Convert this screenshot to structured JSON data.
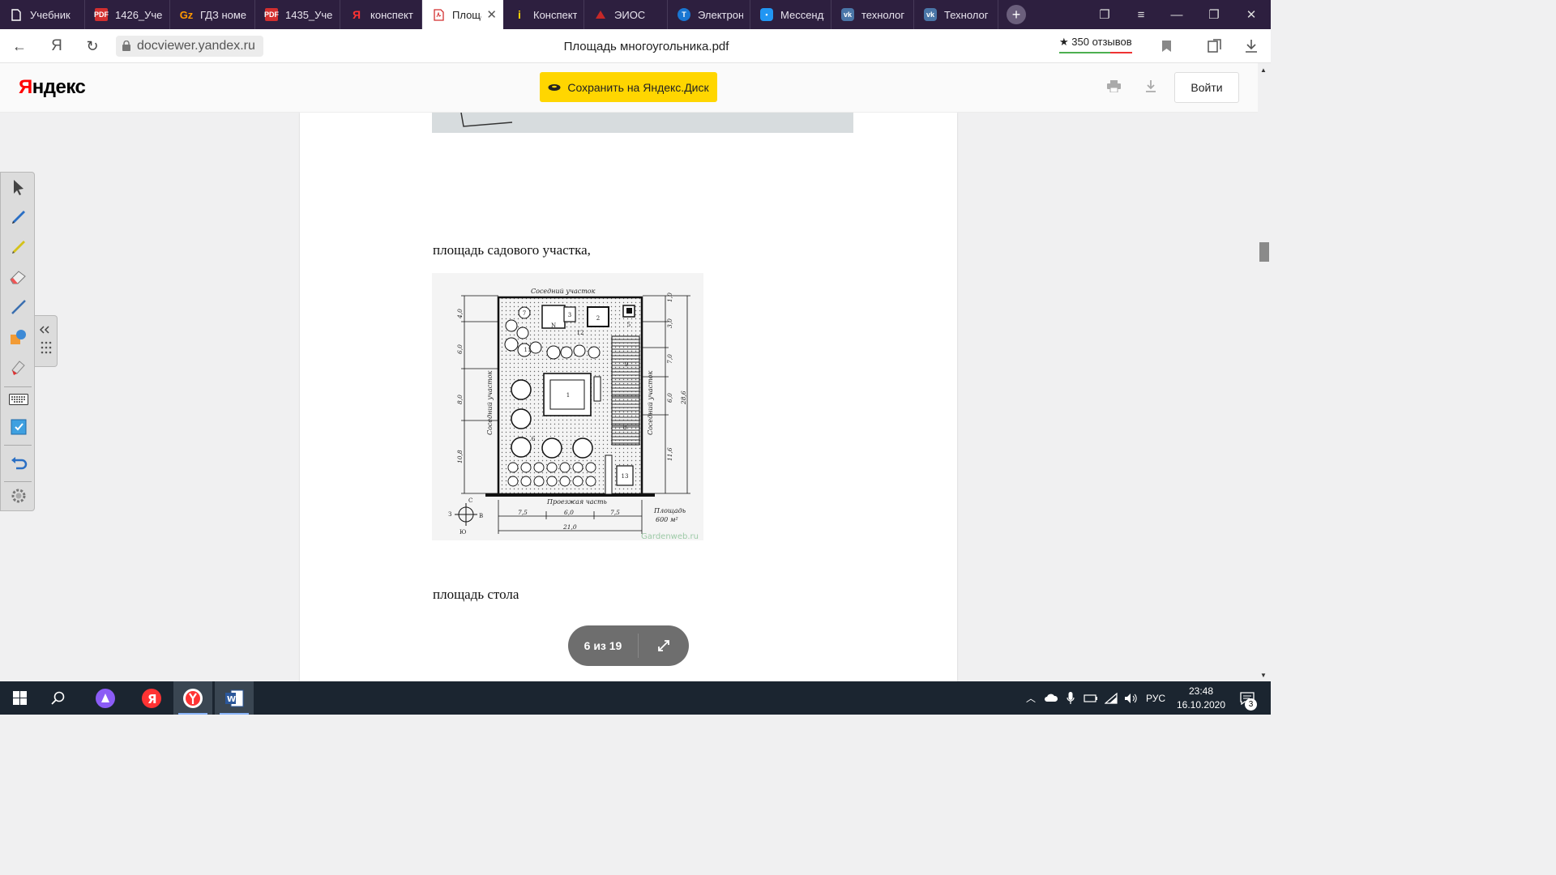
{
  "tabs": [
    {
      "label": "Учебник",
      "icon": "document-icon",
      "active": false
    },
    {
      "label": "1426_Уче",
      "icon": "pdf-icon",
      "active": false
    },
    {
      "label": "ГДЗ номе",
      "icon": "gdz-icon",
      "active": false
    },
    {
      "label": "1435_Уче",
      "icon": "pdf-icon",
      "active": false
    },
    {
      "label": "конспект",
      "icon": "yandex-icon",
      "active": false
    },
    {
      "label": "Площа",
      "icon": "pdf-outline-icon",
      "active": true
    },
    {
      "label": "Конспект",
      "icon": "info-icon",
      "active": false
    },
    {
      "label": "ЭИОС",
      "icon": "eios-icon",
      "active": false
    },
    {
      "label": "Электрон",
      "icon": "electron-icon",
      "active": false
    },
    {
      "label": "Мессендж",
      "icon": "messenger-icon",
      "active": false
    },
    {
      "label": "технолог",
      "icon": "vk-icon",
      "active": false
    },
    {
      "label": "Технолог",
      "icon": "vk-icon",
      "active": false
    }
  ],
  "address_bar": {
    "url": "docviewer.yandex.ru",
    "title": "Площадь многоугольника.pdf",
    "reviews": "★ 350 отзывов"
  },
  "header": {
    "logo_y": "Я",
    "logo_rest": "ндекс",
    "save_button": "Сохранить на Яндекс.Диск",
    "login_button": "Войти"
  },
  "document": {
    "text_1": "площадь садового участка,",
    "text_2": "площадь стола",
    "plan": {
      "top_label": "Соседний участок",
      "left_label": "Соседний участок",
      "right_label": "Соседний участок",
      "road_label": "Проезжая часть",
      "area_label_1": "Площадь",
      "area_label_2": "600 м²",
      "watermark": "Gardenweb.ru",
      "left_dims": [
        "4,0",
        "6,0",
        "8,0",
        "10,8"
      ],
      "right_dims": [
        "3,0",
        "7,0",
        "6,0",
        "11,6"
      ],
      "right_total": "28,6",
      "top_right_dim": "1,0",
      "bottom_dims": [
        "7,5",
        "6,0",
        "7,5"
      ],
      "bottom_total": "21,0",
      "compass": [
        "С",
        "З",
        "В",
        "Ю"
      ],
      "numbers": [
        "7",
        "3",
        "2",
        "N",
        "12",
        "5",
        "11",
        "9",
        "1",
        "8",
        "6",
        "13"
      ]
    }
  },
  "pager": {
    "label": "6 из 19"
  },
  "taskbar": {
    "language": "РУС",
    "time": "23:48",
    "date": "16.10.2020",
    "notifications": "3"
  },
  "colors": {
    "tabbar": "#2d1f3f",
    "save_button": "#ffd600",
    "taskbar": "#1b2530",
    "yandex_red": "#ff0000"
  }
}
